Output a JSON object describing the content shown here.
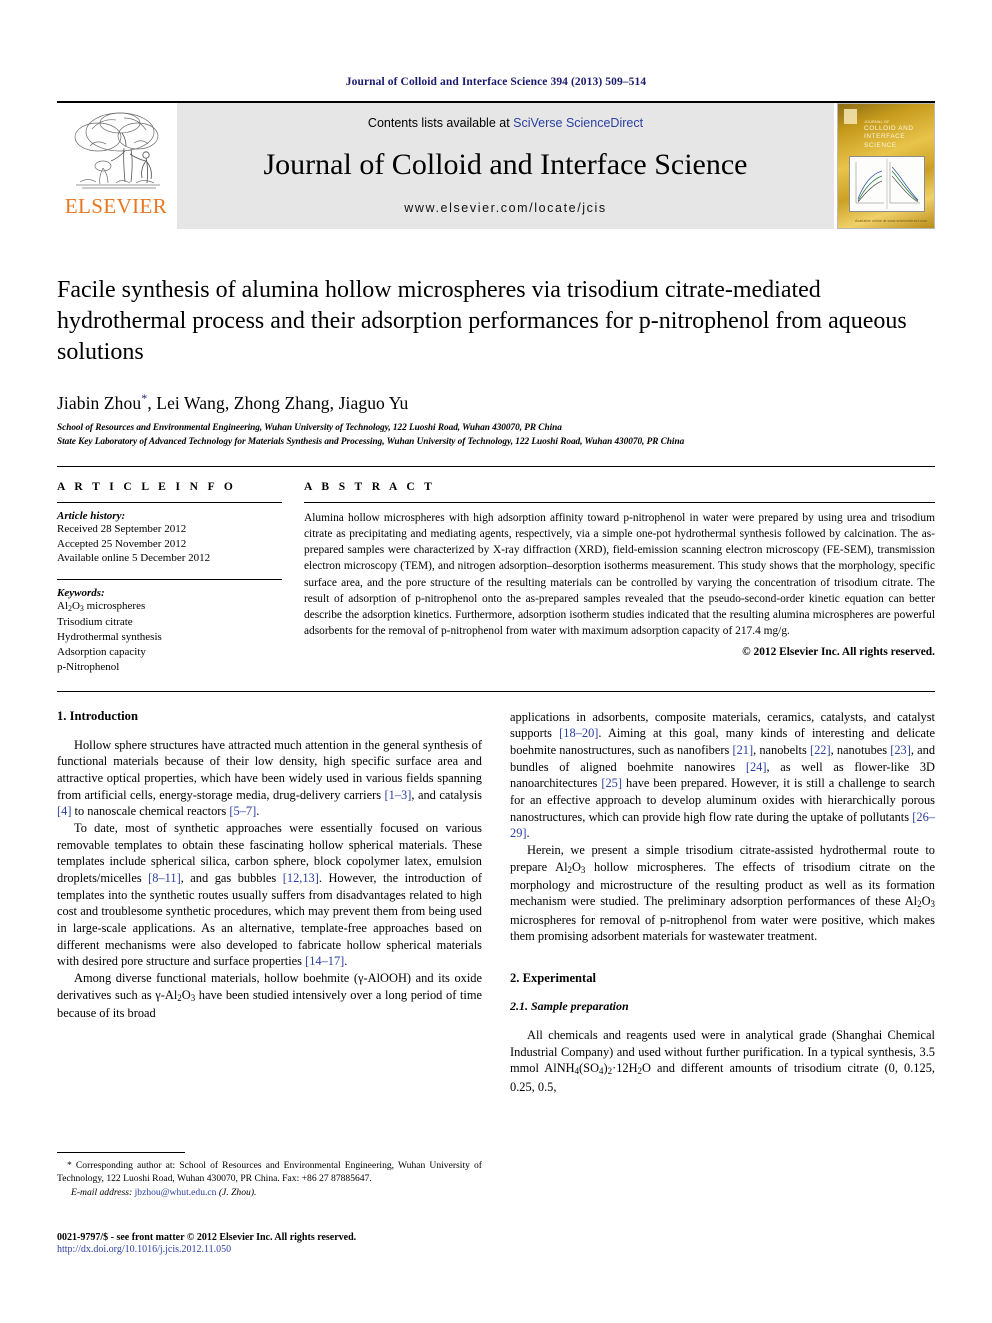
{
  "running_head": "Journal of Colloid and Interface Science 394 (2013) 509–514",
  "masthead": {
    "publisher_name": "ELSEVIER",
    "contents_prefix": "Contents lists available at ",
    "sciencedirect_link": "SciVerse ScienceDirect",
    "journal_title": "Journal of Colloid and Interface Science",
    "journal_url": "www.elsevier.com/locate/jcis",
    "cover_title": "COLLOID AND INTERFACE SCIENCE",
    "cover_top_label": "JOURNAL OF",
    "cover_footer": "Available online at www.sciencedirect.com",
    "link_color": "#2b3fa0",
    "banner_bg": "#e6e6e6",
    "elsevier_orange": "#E87722"
  },
  "article": {
    "title": "Facile synthesis of alumina hollow microspheres via trisodium citrate-mediated hydrothermal process and their adsorption performances for p-nitrophenol from aqueous solutions",
    "authors": "Jiabin Zhou",
    "authors_rest": ", Lei Wang, Zhong Zhang, Jiaguo Yu",
    "corresponding_marker": "*",
    "affiliation_1": "School of Resources and Environmental Engineering, Wuhan University of Technology, 122 Luoshi Road, Wuhan 430070, PR China",
    "affiliation_2": "State Key Laboratory of Advanced Technology for Materials Synthesis and Processing, Wuhan University of Technology, 122 Luoshi Road, Wuhan 430070, PR China"
  },
  "article_info": {
    "heading": "A R T I C L E    I N F O",
    "history_label": "Article history:",
    "received": "Received 28 September 2012",
    "accepted": "Accepted 25 November 2012",
    "available": "Available online 5 December 2012",
    "keywords_label": "Keywords:",
    "keywords": [
      "Al2O3 microspheres",
      "Trisodium citrate",
      "Hydrothermal synthesis",
      "Adsorption capacity",
      "p-Nitrophenol"
    ]
  },
  "abstract": {
    "heading": "A B S T R A C T",
    "text": "Alumina hollow microspheres with high adsorption affinity toward p-nitrophenol in water were prepared by using urea and trisodium citrate as precipitating and mediating agents, respectively, via a simple one-pot hydrothermal synthesis followed by calcination. The as-prepared samples were characterized by X-ray diffraction (XRD), field-emission scanning electron microscopy (FE-SEM), transmission electron microscopy (TEM), and nitrogen adsorption–desorption isotherms measurement. This study shows that the morphology, specific surface area, and the pore structure of the resulting materials can be controlled by varying the concentration of trisodium citrate. The result of adsorption of p-nitrophenol onto the as-prepared samples revealed that the pseudo-second-order kinetic equation can better describe the adsorption kinetics. Furthermore, adsorption isotherm studies indicated that the resulting alumina microspheres are powerful adsorbents for the removal of p-nitrophenol from water with maximum adsorption capacity of 217.4 mg/g.",
    "copyright": "© 2012 Elsevier Inc. All rights reserved."
  },
  "body": {
    "intro_heading": "1. Introduction",
    "intro_p1_a": "Hollow sphere structures have attracted much attention in the general synthesis of functional materials because of their low density, high specific surface area and attractive optical properties, which have been widely used in various fields spanning from artificial cells, energy-storage media, drug-delivery carriers ",
    "intro_p1_c1": "[1–3]",
    "intro_p1_b": ", and catalysis ",
    "intro_p1_c2": "[4]",
    "intro_p1_c": " to nanoscale chemical reactors ",
    "intro_p1_c3": "[5–7]",
    "intro_p1_d": ".",
    "intro_p2_a": "To date, most of synthetic approaches were essentially focused on various removable templates to obtain these fascinating hollow spherical materials. These templates include spherical silica, carbon sphere, block copolymer latex, emulsion droplets/micelles ",
    "intro_p2_c1": "[8–11]",
    "intro_p2_b": ", and gas bubbles ",
    "intro_p2_c2": "[12,13]",
    "intro_p2_c": ". However, the introduction of templates into the synthetic routes usually suffers from disadvantages related to high cost and troublesome synthetic procedures, which may prevent them from being used in large-scale applications. As an alternative, template-free approaches based on different mechanisms were also developed to fabricate hollow spherical materials with desired pore structure and surface properties ",
    "intro_p2_c3": "[14–17]",
    "intro_p2_d": ".",
    "intro_p3_a": "Among diverse functional materials, hollow boehmite (γ-AlOOH) and its oxide derivatives such as γ-Al2O3 have been studied intensively over a long period of time because of its broad",
    "intro_p4_a": "applications in adsorbents, composite materials, ceramics, catalysts, and catalyst supports ",
    "intro_p4_c1": "[18–20]",
    "intro_p4_b": ". Aiming at this goal, many kinds of interesting and delicate boehmite nanostructures, such as nanofibers ",
    "intro_p4_c2": "[21]",
    "intro_p4_c": ", nanobelts ",
    "intro_p4_c3": "[22]",
    "intro_p4_d": ", nanotubes ",
    "intro_p4_c4": "[23]",
    "intro_p4_e": ", and bundles of aligned boehmite nanowires ",
    "intro_p4_c5": "[24]",
    "intro_p4_f": ", as well as flower-like 3D nanoarchitectures ",
    "intro_p4_c6": "[25]",
    "intro_p4_g": " have been prepared. However, it is still a challenge to search for an effective approach to develop aluminum oxides with hierarchically porous nanostructures, which can provide high flow rate during the uptake of pollutants ",
    "intro_p4_c7": "[26–29]",
    "intro_p4_h": ".",
    "intro_p5_a": "Herein, we present a simple trisodium citrate-assisted hydrothermal route to prepare Al2O3 hollow microspheres. The effects of trisodium citrate on the morphology and microstructure of the resulting product as well as its formation mechanism were studied. The preliminary adsorption performances of these Al2O3 microspheres for removal of p-nitrophenol from water were positive, which makes them promising adsorbent materials for wastewater treatment.",
    "experimental_heading": "2. Experimental",
    "sample_prep_heading": "2.1. Sample preparation",
    "sample_prep_p1": "All chemicals and reagents used were in analytical grade (Shanghai Chemical Industrial Company) and used without further purification. In a typical synthesis, 3.5 mmol AlNH4(SO4)2·12H2O and different amounts of trisodium citrate (0, 0.125, 0.25, 0.5,"
  },
  "footnote": {
    "text": "* Corresponding author at: School of Resources and Environmental Engineering, Wuhan University of Technology, 122 Luoshi Road, Wuhan 430070, PR China. Fax: +86 27 87885647.",
    "email_label": "E-mail address:",
    "email": "jbzhou@whut.edu.cn",
    "email_suffix": " (J. Zhou)."
  },
  "footer": {
    "front_matter": "0021-9797/$ - see front matter © 2012 Elsevier Inc. All rights reserved.",
    "doi": "http://dx.doi.org/10.1016/j.jcis.2012.11.050"
  }
}
